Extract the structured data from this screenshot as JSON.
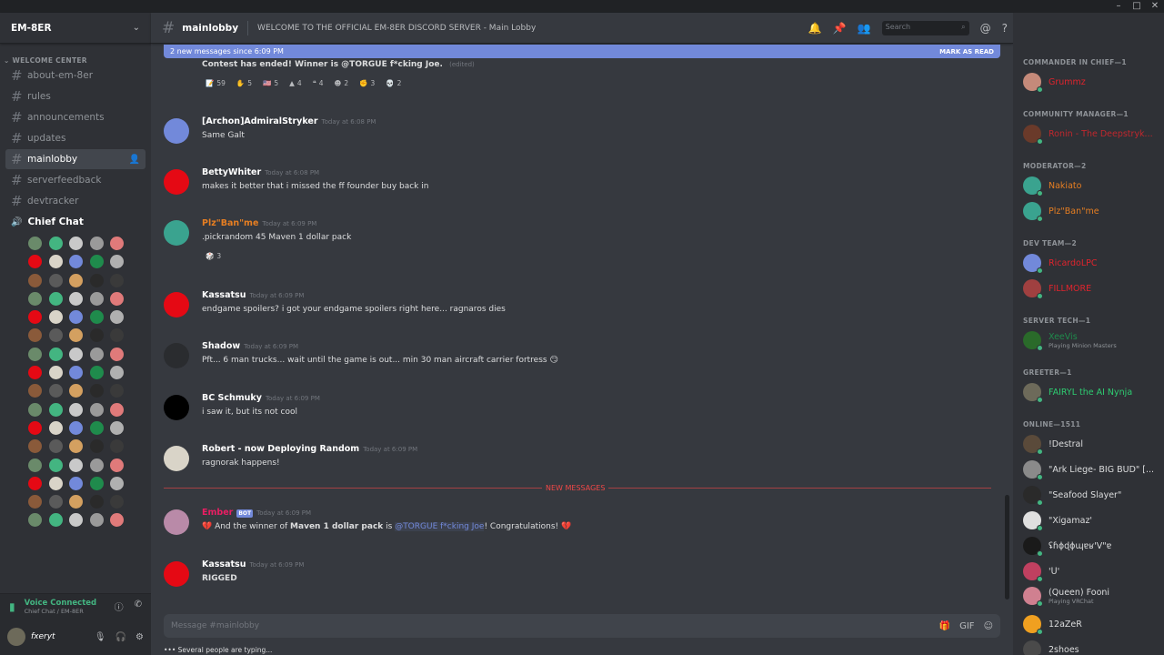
{
  "window": {
    "controls": [
      "–",
      "□",
      "✕"
    ]
  },
  "server": {
    "name": "EM-8ER"
  },
  "category": "WELCOME CENTER",
  "channels": [
    {
      "name": "about-em-8er"
    },
    {
      "name": "rules"
    },
    {
      "name": "announcements"
    },
    {
      "name": "updates"
    },
    {
      "name": "mainlobby",
      "active": true
    },
    {
      "name": "serverfeedback"
    },
    {
      "name": "devtracker"
    }
  ],
  "voice_channel": "Chief Chat",
  "voice_status": {
    "title": "Voice Connected",
    "sub": "Chief Chat / EM-8ER"
  },
  "user": {
    "name": "fxeryt"
  },
  "header": {
    "channel": "mainlobby",
    "topic": "WELCOME TO THE OFFICIAL EM-8ER DISCORD SERVER - Main Lobby",
    "search": "Search"
  },
  "new_messages_bar": {
    "text": "2 new messages since 6:09 PM",
    "action": "MARK AS READ"
  },
  "messages": [
    {
      "author": "",
      "ts": "",
      "body": "Contest has ended! Winner is @TORGUE f*cking Joe.",
      "edited": "(edited)"
    },
    {
      "author": "[Archon]AdmiralStryker",
      "ts": "Today at 6:08 PM",
      "body": "Same Galt"
    },
    {
      "author": "BettyWhiter",
      "ts": "Today at 6:08 PM",
      "body": "makes it better that i missed the ff founder buy back in"
    },
    {
      "author": "Plz\"Ban\"me",
      "ts": "Today at 6:09 PM",
      "body": ".pickrandom 45 Maven 1 dollar pack"
    },
    {
      "author": "Kassatsu",
      "ts": "Today at 6:09 PM",
      "body": "endgame spoilers? i got your endgame spoilers right here... ragnaros dies"
    },
    {
      "author": "Shadow",
      "ts": "Today at 6:09 PM",
      "body": "Pft... 6 man trucks... wait until the game is out... min 30 man aircraft carrier fortress 😏"
    },
    {
      "author": "BC Schmuky",
      "ts": "Today at 6:09 PM",
      "body": "i saw it, but its not cool"
    },
    {
      "author": "Robert - now Deploying Random",
      "ts": "Today at 6:09 PM",
      "body": "ragnorak happens!"
    },
    {
      "author": "Ember",
      "ts": "Today at 6:09 PM",
      "bot": "BOT",
      "body_pre": "💔 And the winner of ",
      "body_bold": "Maven 1 dollar pack",
      "body_mid": " is ",
      "body_mention": "@TORGUE f*cking Joe",
      "body_post": "! Congratulations! 💔"
    },
    {
      "author": "Kassatsu",
      "ts": "Today at 6:09 PM",
      "body": "RIGGED"
    }
  ],
  "reactions": [
    {
      "emoji": "📝",
      "count": "59"
    },
    {
      "emoji": "✋",
      "count": "5"
    },
    {
      "emoji": "🇺🇸",
      "count": "5"
    },
    {
      "emoji": "▲",
      "count": "4"
    },
    {
      "emoji": "❝",
      "count": "4"
    },
    {
      "emoji": "☻",
      "count": "2"
    },
    {
      "emoji": "✊",
      "count": "3"
    },
    {
      "emoji": "💀",
      "count": "2"
    }
  ],
  "pick_reaction": {
    "emoji": "🎲",
    "count": "3"
  },
  "divider": "NEW MESSAGES",
  "input": {
    "placeholder": "Message #mainlobby"
  },
  "typing": "Several people are typing...",
  "roles": [
    {
      "label": "COMMANDER IN CHIEF—1"
    },
    {
      "label": "COMMUNITY MANAGER—1"
    },
    {
      "label": "MODERATOR—2"
    },
    {
      "label": "DEV TEAM—2"
    },
    {
      "label": "SERVER TECH—1"
    },
    {
      "label": "GREETER—1"
    },
    {
      "label": "ONLINE—1511"
    }
  ],
  "members": [
    {
      "name": "Grummz",
      "color": "#e0242d"
    },
    {
      "name": "Ronin - The Deepstryk...",
      "color": "#c1272d"
    },
    {
      "name": "Nakiato",
      "color": "#e67e22"
    },
    {
      "name": "Plz\"Ban\"me",
      "color": "#e67e22"
    },
    {
      "name": "RicardoLPC",
      "color": "#e0242d"
    },
    {
      "name": "FILLMORE",
      "color": "#e0242d"
    },
    {
      "name": "XeeVis",
      "color": "#1f8b4c",
      "sub": "Playing Minion Masters"
    },
    {
      "name": "FAIRYL the AI Nynja",
      "color": "#2ecc71"
    },
    {
      "name": "!Destral",
      "color": "#dcddde"
    },
    {
      "name": "\"Ark Liege- BIG BUD\" [...",
      "color": "#dcddde"
    },
    {
      "name": "\"Seafood Slayer\"",
      "color": "#dcddde"
    },
    {
      "name": "\"Xigamaz'",
      "color": "#dcddde"
    },
    {
      "name": "ʢɦɸɖɸɰɐʁ'V\"ɐ",
      "color": "#dcddde"
    },
    {
      "name": "'ᑌ'",
      "color": "#dcddde"
    },
    {
      "name": "(Queen) Fooni",
      "color": "#dcddde",
      "sub": "Playing VRChat"
    },
    {
      "name": "12aZeR",
      "color": "#dcddde"
    },
    {
      "name": "2shoes",
      "color": "#dcddde"
    }
  ]
}
